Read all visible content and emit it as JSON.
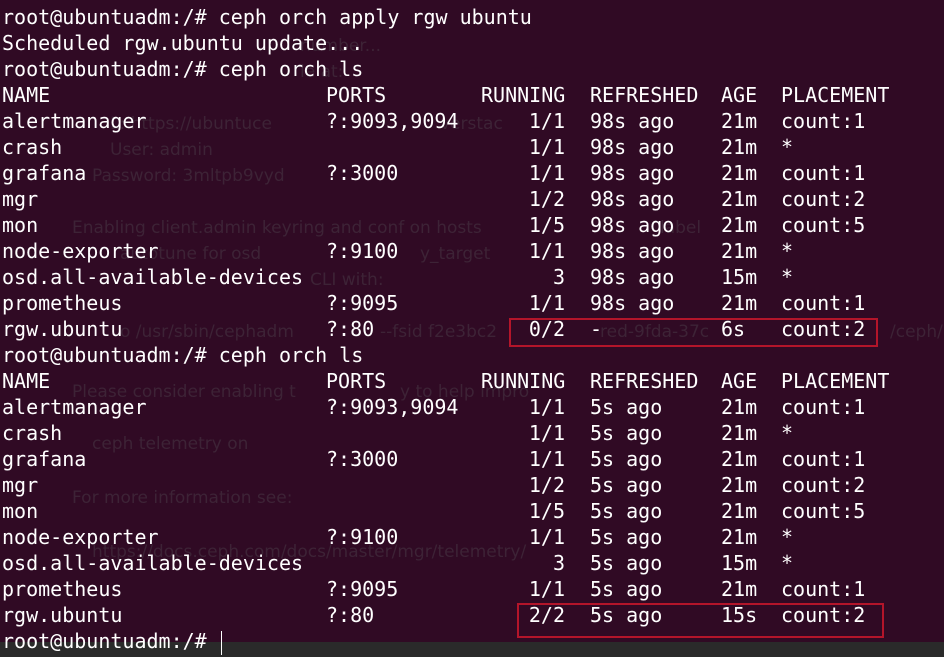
{
  "terminal": {
    "background": "#300a24",
    "text_color": "#ffffff",
    "highlight_color": "#b3152a",
    "prompt": "root@ubuntuadm:/# ",
    "commands": {
      "apply": "ceph orch apply rgw ubuntu",
      "apply_output": "Scheduled rgw.ubuntu update...",
      "ls_1": "ceph orch ls",
      "ls_2": "ceph orch ls"
    },
    "headers": {
      "name": "NAME",
      "ports": "PORTS",
      "running": "RUNNING",
      "refreshed": "REFRESHED",
      "age": "AGE",
      "placement": "PLACEMENT"
    },
    "table_1": [
      {
        "name": "alertmanager",
        "ports": "?:9093,9094",
        "running": "1/1",
        "refreshed": "98s ago",
        "age": "21m",
        "placement": "count:1"
      },
      {
        "name": "crash",
        "ports": "",
        "running": "1/1",
        "refreshed": "98s ago",
        "age": "21m",
        "placement": "*"
      },
      {
        "name": "grafana",
        "ports": "?:3000",
        "running": "1/1",
        "refreshed": "98s ago",
        "age": "21m",
        "placement": "count:1"
      },
      {
        "name": "mgr",
        "ports": "",
        "running": "1/2",
        "refreshed": "98s ago",
        "age": "21m",
        "placement": "count:2"
      },
      {
        "name": "mon",
        "ports": "",
        "running": "1/5",
        "refreshed": "98s ago",
        "age": "21m",
        "placement": "count:5"
      },
      {
        "name": "node-exporter",
        "ports": "?:9100",
        "running": "1/1",
        "refreshed": "98s ago",
        "age": "21m",
        "placement": "*"
      },
      {
        "name": "osd.all-available-devices",
        "ports": "",
        "running": "3",
        "refreshed": "98s ago",
        "age": "15m",
        "placement": "*"
      },
      {
        "name": "prometheus",
        "ports": "?:9095",
        "running": "1/1",
        "refreshed": "98s ago",
        "age": "21m",
        "placement": "count:1"
      },
      {
        "name": "rgw.ubuntu",
        "ports": "?:80",
        "running": "0/2",
        "refreshed": "-",
        "age": "6s",
        "placement": "count:2"
      }
    ],
    "table_2": [
      {
        "name": "alertmanager",
        "ports": "?:9093,9094",
        "running": "1/1",
        "refreshed": "5s ago",
        "age": "21m",
        "placement": "count:1"
      },
      {
        "name": "crash",
        "ports": "",
        "running": "1/1",
        "refreshed": "5s ago",
        "age": "21m",
        "placement": "*"
      },
      {
        "name": "grafana",
        "ports": "?:3000",
        "running": "1/1",
        "refreshed": "5s ago",
        "age": "21m",
        "placement": "count:1"
      },
      {
        "name": "mgr",
        "ports": "",
        "running": "1/2",
        "refreshed": "5s ago",
        "age": "21m",
        "placement": "count:2"
      },
      {
        "name": "mon",
        "ports": "",
        "running": "1/5",
        "refreshed": "5s ago",
        "age": "21m",
        "placement": "count:5"
      },
      {
        "name": "node-exporter",
        "ports": "?:9100",
        "running": "1/1",
        "refreshed": "5s ago",
        "age": "21m",
        "placement": "*"
      },
      {
        "name": "osd.all-available-devices",
        "ports": "",
        "running": "3",
        "refreshed": "5s ago",
        "age": "15m",
        "placement": "*"
      },
      {
        "name": "prometheus",
        "ports": "?:9095",
        "running": "1/1",
        "refreshed": "5s ago",
        "age": "21m",
        "placement": "count:1"
      },
      {
        "name": "rgw.ubuntu",
        "ports": "?:80",
        "running": "2/2",
        "refreshed": "5s ago",
        "age": "15s",
        "placement": "count:2"
      }
    ]
  },
  "background_text": {
    "l1": "number...",
    "l2": "le at:",
    "l3": "L: https://ubuntuce",
    "l4": "verstac",
    "l5": "User: admin",
    "l6": "Password: 3mltpb9vyd",
    "l7": "Enabling client.admin keyring and conf on hosts",
    "l8": "label",
    "l9": "autotune for osd",
    "l10": "y_target",
    "l11": "CLI with:",
    "l12": "o /usr/sbin/cephadm",
    "l13": "--fsid f2e3bc2",
    "l14": "red-9fda-37c",
    "l15": "/ceph/",
    "l16": "Please consider enabling t",
    "l17": "y to help impro",
    "l18": "ceph telemetry on",
    "l19": "For more information see:",
    "l20": "https://docs.ceph.com/docs/master/mgr/telemetry/"
  }
}
